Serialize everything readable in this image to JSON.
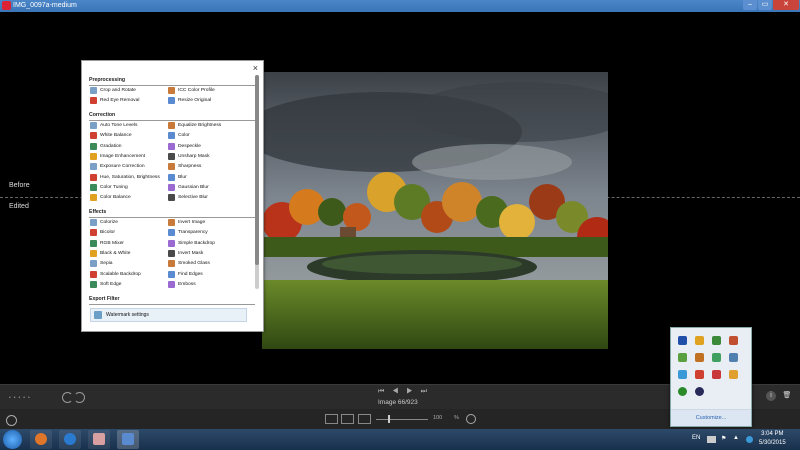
{
  "window": {
    "title": "IMG_0097a-medium",
    "min": "–",
    "max": "▭",
    "close": "✕"
  },
  "sidebar": {
    "before": "Before",
    "edited": "Edited"
  },
  "panel": {
    "close": "×",
    "sections": {
      "preprocessing": "Preprocessing",
      "correction": "Correction",
      "effects": "Effects",
      "export": "Export Filter"
    },
    "preprocessing": [
      "Crop and Rotate",
      "ICC Color Profile",
      "Red Eye Removal",
      "Resize Original"
    ],
    "correction": [
      "Auto Tone Levels",
      "Equalize Brightness",
      "White Balance",
      "Color",
      "Gradation",
      "Despeckle",
      "Image Enhancement",
      "Unsharp Mask",
      "Exposure Correction",
      "Sharpness",
      "Hue, Saturation, Brightness",
      "Blur",
      "Color Tuning",
      "Gaussian Blur",
      "Color Balance",
      "Selective Blur"
    ],
    "effects": [
      "Colorize",
      "Invert Image",
      "Bicolor",
      "Transparency",
      "RGB Mixer",
      "Simple Backdrop",
      "Black & White",
      "Invert Mask",
      "Sepia",
      "Smoked Glass",
      "Scalable Backdrop",
      "Find Edges",
      "Soft Edge",
      "Emboss"
    ],
    "export": [
      "Watermark settings"
    ]
  },
  "toolbar": {
    "nav": "⏮ ◀ ▶ ⏭",
    "counter": "Image 66/923",
    "zoom_value": "100",
    "zoom_unit": "%",
    "info_icon": "i",
    "trash_icon": "🗑"
  },
  "tray": {
    "customize": "Customize..."
  },
  "taskbar": {
    "lang": "EN",
    "time": "3:04 PM",
    "date": "5/30/2015"
  },
  "colors": {
    "accent": "#3a75b8",
    "tray_link": "#2a64b0"
  }
}
